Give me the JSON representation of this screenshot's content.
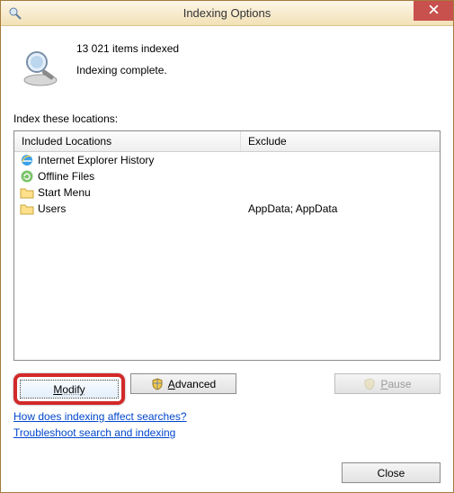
{
  "window": {
    "title": "Indexing Options"
  },
  "status": {
    "count_line": "13 021 items indexed",
    "state_line": "Indexing complete."
  },
  "locations_label": "Index these locations:",
  "columns": {
    "included": "Included Locations",
    "exclude": "Exclude"
  },
  "rows": [
    {
      "icon": "ie",
      "name": "Internet Explorer History",
      "exclude": ""
    },
    {
      "icon": "sync",
      "name": "Offline Files",
      "exclude": ""
    },
    {
      "icon": "folder",
      "name": "Start Menu",
      "exclude": ""
    },
    {
      "icon": "folder",
      "name": "Users",
      "exclude": "AppData; AppData"
    }
  ],
  "buttons": {
    "modify": "Modify",
    "advanced": "Advanced",
    "pause": "Pause",
    "close": "Close"
  },
  "links": {
    "how": "How does indexing affect searches?",
    "troubleshoot": "Troubleshoot search and indexing"
  }
}
